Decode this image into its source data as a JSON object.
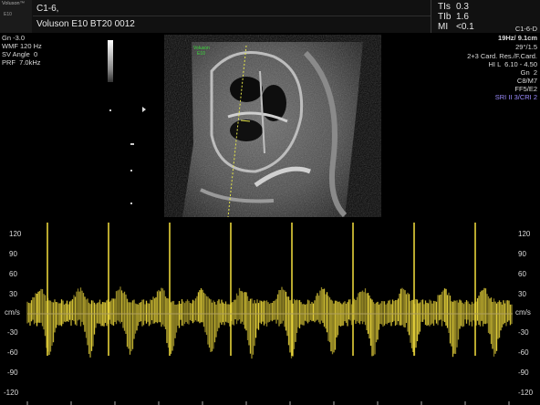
{
  "brand": {
    "name": "Voluson™",
    "model": "E10"
  },
  "header": {
    "line1": "C1-6,",
    "line2": "Voluson E10 BT20 0012",
    "thermal": [
      {
        "label": "TIs",
        "value": "0.3"
      },
      {
        "label": "TIb",
        "value": "1.6"
      },
      {
        "label": "MI",
        "value": "<0.1"
      }
    ]
  },
  "left_params": [
    "Gn -3.0",
    "WMF 120 Hz",
    "SV Angle  0",
    "PRF  7.0kHz"
  ],
  "right_params": {
    "probe": "C1-6-D",
    "depth": "19Hz/ 9.1cm",
    "angle": "29°/1.5",
    "preset": "2+3 Card. Res./F.Card.",
    "hi": "HI L  6.10 - 4.50",
    "gain": "Gn  2",
    "map": "C8/M7",
    "ff": "FF5/E2",
    "sri": "SRI II 3/CRI 2"
  },
  "bmode_logo": {
    "line1": "Voluson",
    "line2": "E10"
  },
  "doppler_scale": {
    "unit": "cm/s",
    "ticks": [
      "120",
      "90",
      "60",
      "30",
      "-30",
      "-60",
      "-90",
      "-120"
    ]
  },
  "colors": {
    "waveform": "#e6d23a",
    "baseline": "#b0a060",
    "sri": "#9c8cff"
  }
}
